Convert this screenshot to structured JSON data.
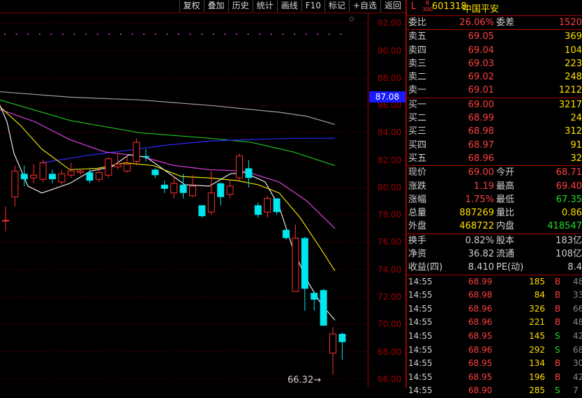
{
  "toolbar": {
    "buttons": [
      "复权",
      "叠加",
      "历史",
      "统计",
      "画线",
      "F10",
      "标记",
      "+自选",
      "返回"
    ]
  },
  "axis": {
    "labels": [
      "92.00",
      "90.00",
      "88.00",
      "86.00",
      "84.00",
      "82.00",
      "80.00",
      "78.00",
      "76.00",
      "74.00",
      "72.00",
      "70.00",
      "68.00",
      "66.00"
    ]
  },
  "current_price_tag": "87.08",
  "low_label": "66.32",
  "header": {
    "letter": "L",
    "badge_r": "R",
    "badge_num": "300",
    "code": "601318",
    "name": "中国平安"
  },
  "wb": {
    "wb_label": "委比",
    "wb_val": "26.06%",
    "wc_label": "委差",
    "wc_val": "1520"
  },
  "asks": [
    {
      "label": "卖五",
      "price": "69.05",
      "vol": "369"
    },
    {
      "label": "卖四",
      "price": "69.04",
      "vol": "104"
    },
    {
      "label": "卖三",
      "price": "69.03",
      "vol": "223"
    },
    {
      "label": "卖二",
      "price": "69.02",
      "vol": "248"
    },
    {
      "label": "卖一",
      "price": "69.01",
      "vol": "1212"
    }
  ],
  "bids": [
    {
      "label": "买一",
      "price": "69.00",
      "vol": "3217"
    },
    {
      "label": "买二",
      "price": "68.99",
      "vol": "24"
    },
    {
      "label": "买三",
      "price": "68.98",
      "vol": "312"
    },
    {
      "label": "买四",
      "price": "68.97",
      "vol": "91"
    },
    {
      "label": "买五",
      "price": "68.96",
      "vol": "32"
    }
  ],
  "quote": [
    {
      "l1": "现价",
      "v1": "69.00",
      "l2": "今开",
      "v2": "68.71",
      "c2": "red"
    },
    {
      "l1": "涨跌",
      "v1": "1.19",
      "l2": "最高",
      "v2": "69.40",
      "c2": "red"
    },
    {
      "l1": "涨幅",
      "v1": "1.75%",
      "l2": "最低",
      "v2": "67.35",
      "c2": "green"
    },
    {
      "l1": "总量",
      "v1": "887269",
      "l2": "量比",
      "v2": "0.86",
      "c2": "yellow"
    },
    {
      "l1": "外盘",
      "v1": "468722",
      "l2": "内盘",
      "v2": "418547",
      "c2": "green"
    }
  ],
  "fund": [
    {
      "l1": "换手",
      "v1": "0.82%",
      "l2": "股本",
      "v2": "183亿"
    },
    {
      "l1": "净资",
      "v1": "36.82",
      "l2": "流通",
      "v2": "108亿"
    },
    {
      "l1": "收益(四)",
      "v1": "8.410",
      "l2": "PE(动)",
      "v2": "8.4"
    }
  ],
  "ticks": [
    {
      "time": "14:55",
      "price": "68.99",
      "vol": "185",
      "dir": "B",
      "num": "48"
    },
    {
      "time": "14:55",
      "price": "68.98",
      "vol": "84",
      "dir": "B",
      "num": "33"
    },
    {
      "time": "14:55",
      "price": "68.96",
      "vol": "326",
      "dir": "B",
      "num": "66"
    },
    {
      "time": "14:55",
      "price": "68.96",
      "vol": "221",
      "dir": "B",
      "num": "48"
    },
    {
      "time": "14:55",
      "price": "68.95",
      "vol": "145",
      "dir": "S",
      "num": "42"
    },
    {
      "time": "14:55",
      "price": "68.96",
      "vol": "292",
      "dir": "S",
      "num": "68"
    },
    {
      "time": "14:55",
      "price": "68.95",
      "vol": "134",
      "dir": "B",
      "num": "30"
    },
    {
      "time": "14:55",
      "price": "68.95",
      "vol": "196",
      "dir": "B",
      "num": "42"
    },
    {
      "time": "14:55",
      "price": "68.90",
      "vol": "285",
      "dir": "S",
      "num": "7"
    }
  ],
  "colors": {
    "up": "#ff3030",
    "down": "#00e5ee",
    "ma5": "#e8e8e8",
    "ma10": "#e8e000",
    "ma20": "#e040e0",
    "ma30": "#20c020",
    "ma60": "#2a2aff",
    "ma120": "#a0a0a0",
    "grid": "#7a0000"
  },
  "chart_data": {
    "type": "candlestick",
    "ylim": [
      66,
      93
    ],
    "candles": [
      [
        77.6,
        77.6,
        76.8,
        78.6
      ],
      [
        79.3,
        81.2,
        78.6,
        81.6
      ],
      [
        81.0,
        80.6,
        80.1,
        81.6
      ],
      [
        80.7,
        80.9,
        80.3,
        81.7
      ],
      [
        80.6,
        81.8,
        80.4,
        82.0
      ],
      [
        81.0,
        80.6,
        80.3,
        81.3
      ],
      [
        80.4,
        81.0,
        80.2,
        81.3
      ],
      [
        80.9,
        81.2,
        80.7,
        81.8
      ],
      [
        81.1,
        81.2,
        80.9,
        81.4
      ],
      [
        81.1,
        80.5,
        80.3,
        81.3
      ],
      [
        80.6,
        81.1,
        80.4,
        81.4
      ],
      [
        80.9,
        82.1,
        80.7,
        82.2
      ],
      [
        81.5,
        81.7,
        81.3,
        82.5
      ],
      [
        81.2,
        81.7,
        81.1,
        82.3
      ],
      [
        81.9,
        83.3,
        81.6,
        83.6
      ],
      [
        82.3,
        82.2,
        81.9,
        82.8
      ],
      [
        81.3,
        80.9,
        80.7,
        81.4
      ],
      [
        80.2,
        79.9,
        79.6,
        80.5
      ],
      [
        79.6,
        80.3,
        79.2,
        80.8
      ],
      [
        80.2,
        79.6,
        79.2,
        81.0
      ],
      [
        79.4,
        80.1,
        79.3,
        80.9
      ],
      [
        78.7,
        77.9,
        77.8,
        78.7
      ],
      [
        78.2,
        79.6,
        78.0,
        81.2
      ],
      [
        80.3,
        79.3,
        78.7,
        80.4
      ],
      [
        79.5,
        80.1,
        79.2,
        80.6
      ],
      [
        80.7,
        82.3,
        80.4,
        82.5
      ],
      [
        81.4,
        80.7,
        80.0,
        82.0
      ],
      [
        78.7,
        78.0,
        77.8,
        78.9
      ],
      [
        78.2,
        79.2,
        77.8,
        79.4
      ],
      [
        79.2,
        78.2,
        78.0,
        79.2
      ],
      [
        76.9,
        76.3,
        76.2,
        77.0
      ],
      [
        72.4,
        76.3,
        72.4,
        77.3
      ],
      [
        76.3,
        72.6,
        71.0,
        76.4
      ],
      [
        72.3,
        71.8,
        71.0,
        72.4
      ],
      [
        72.5,
        69.9,
        69.9,
        72.6
      ],
      [
        67.9,
        69.3,
        66.3,
        69.8
      ],
      [
        69.3,
        68.7,
        67.4,
        69.4
      ]
    ],
    "ma5": [
      [
        0,
        86.0
      ],
      [
        10,
        84.8
      ],
      [
        20,
        82.5
      ],
      [
        40,
        80.1
      ],
      [
        60,
        79.6
      ],
      [
        100,
        80.3
      ],
      [
        130,
        81.2
      ],
      [
        160,
        81.5
      ],
      [
        185,
        82.4
      ],
      [
        210,
        82.2
      ],
      [
        235,
        81.3
      ],
      [
        265,
        80.2
      ],
      [
        300,
        80.1
      ],
      [
        330,
        81.0
      ],
      [
        350,
        81.1
      ],
      [
        380,
        80.4
      ],
      [
        400,
        78.6
      ],
      [
        420,
        75.5
      ],
      [
        440,
        73.2
      ],
      [
        460,
        71.5
      ],
      [
        480,
        70.3
      ]
    ],
    "ma10": [
      [
        0,
        85.9
      ],
      [
        30,
        84.5
      ],
      [
        60,
        82.8
      ],
      [
        100,
        81.3
      ],
      [
        140,
        81.4
      ],
      [
        180,
        81.8
      ],
      [
        220,
        81.6
      ],
      [
        260,
        80.8
      ],
      [
        300,
        80.7
      ],
      [
        340,
        80.5
      ],
      [
        370,
        80.2
      ],
      [
        400,
        79.6
      ],
      [
        430,
        77.8
      ],
      [
        460,
        75.5
      ],
      [
        480,
        73.9
      ]
    ],
    "ma20": [
      [
        0,
        85.7
      ],
      [
        50,
        84.8
      ],
      [
        100,
        83.5
      ],
      [
        150,
        82.6
      ],
      [
        200,
        82.3
      ],
      [
        250,
        81.6
      ],
      [
        300,
        81.3
      ],
      [
        350,
        81.2
      ],
      [
        400,
        80.4
      ],
      [
        440,
        79.0
      ],
      [
        480,
        77.0
      ]
    ],
    "ma30": [
      [
        0,
        86.4
      ],
      [
        100,
        84.9
      ],
      [
        200,
        84.0
      ],
      [
        300,
        83.6
      ],
      [
        360,
        83.3
      ],
      [
        420,
        82.6
      ],
      [
        480,
        81.6
      ]
    ],
    "ma60": [
      [
        60,
        81.8
      ],
      [
        120,
        82.3
      ],
      [
        180,
        82.7
      ],
      [
        240,
        83.1
      ],
      [
        300,
        83.4
      ],
      [
        360,
        83.5
      ],
      [
        420,
        83.6
      ],
      [
        480,
        83.6
      ]
    ],
    "ma120": [
      [
        0,
        87.0
      ],
      [
        100,
        86.6
      ],
      [
        200,
        86.4
      ],
      [
        300,
        86.0
      ],
      [
        400,
        85.5
      ],
      [
        440,
        85.2
      ],
      [
        480,
        84.6
      ]
    ]
  }
}
